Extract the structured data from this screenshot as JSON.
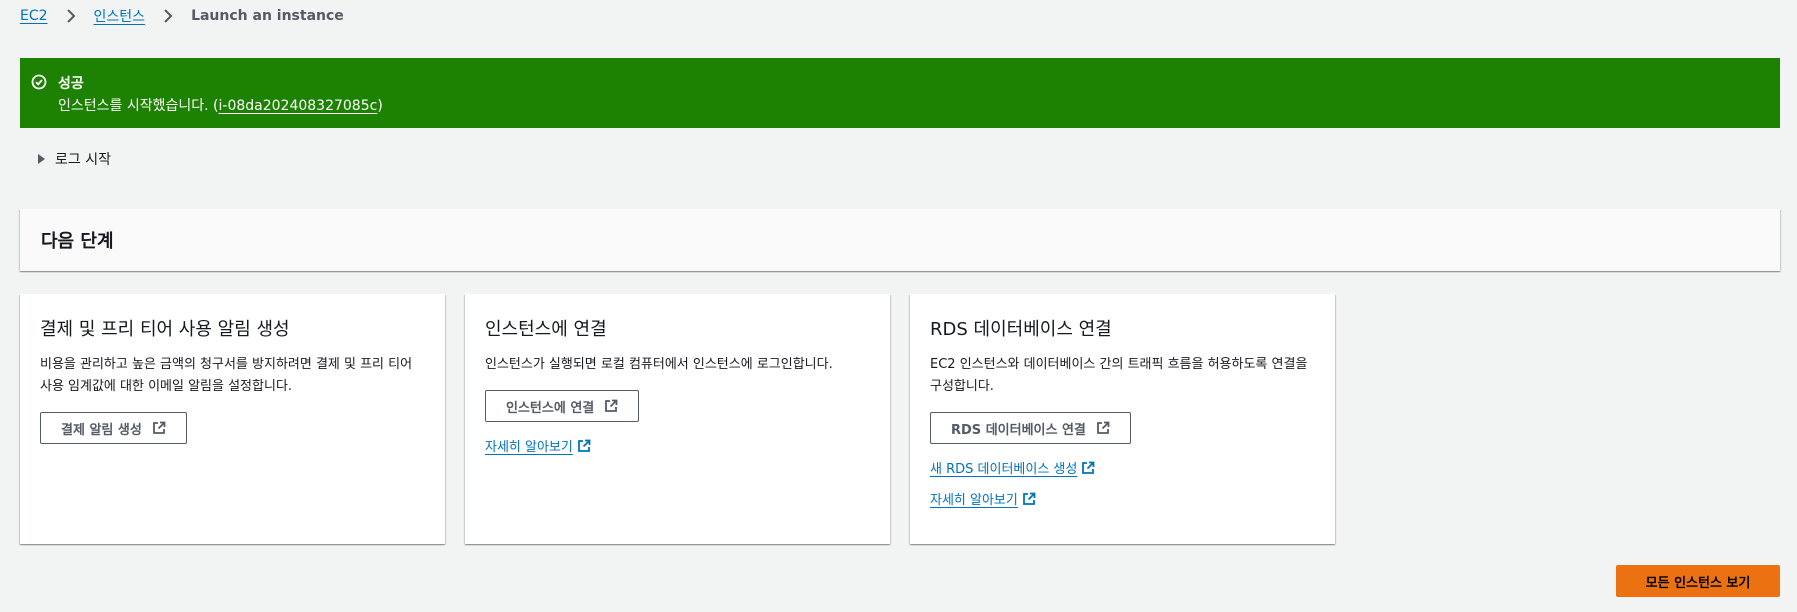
{
  "breadcrumb": {
    "items": [
      "EC2",
      "인스턴스"
    ],
    "current": "Launch an instance"
  },
  "flash": {
    "title": "성공",
    "message_prefix": "인스턴스를 시작했습니다. (",
    "instance_id": "i-08da202408327085c",
    "message_suffix": ")",
    "color": "#1d8102"
  },
  "log": {
    "label": "로그 시작"
  },
  "next_steps": {
    "title": "다음 단계",
    "cards": [
      {
        "title": "결제 및 프리 티어 사용 알림 생성",
        "description": "비용을 관리하고 높은 금액의 청구서를 방지하려면 결제 및 프리 티어 사용 임계값에 대한 이메일 알림을 설정합니다.",
        "button": "결제 알림 생성"
      },
      {
        "title": "인스턴스에 연결",
        "description": "인스턴스가 실행되면 로컬 컴퓨터에서 인스턴스에 로그인합니다.",
        "button": "인스턴스에 연결",
        "links": [
          "자세히 알아보기"
        ]
      },
      {
        "title": "RDS 데이터베이스 연결",
        "description": "EC2 인스턴스와 데이터베이스 간의 트래픽 흐름을 허용하도록 연결을 구성합니다.",
        "button": "RDS 데이터베이스 연결",
        "links": [
          "새 RDS 데이터베이스 생성",
          "자세히 알아보기"
        ]
      }
    ]
  },
  "primary_action": {
    "label": "모든 인스턴스 보기",
    "color": "#ec7211"
  },
  "colors": {
    "link": "#0073bb",
    "background": "#f2f3f3"
  }
}
